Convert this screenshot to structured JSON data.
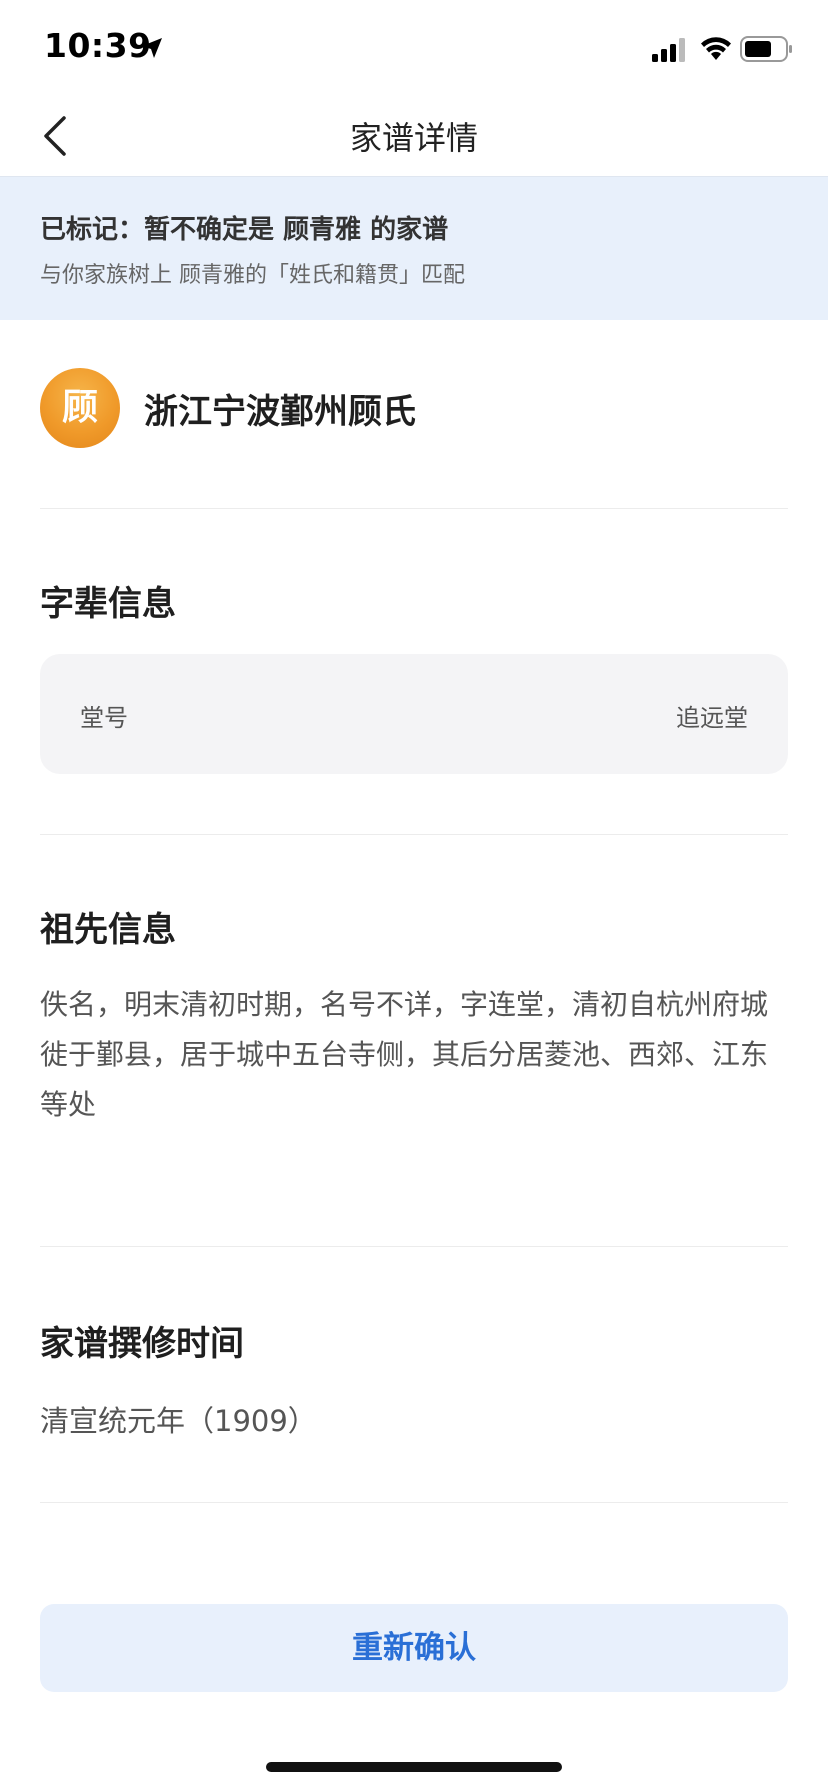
{
  "status_bar": {
    "time": "10:39",
    "icons": [
      "location-arrow-icon",
      "signal-icon",
      "wifi-icon",
      "battery-icon"
    ]
  },
  "nav": {
    "back_icon": "chevron-left-icon",
    "title": "家谱详情"
  },
  "notice": {
    "title": "已标记：暂不确定是 顾青雅 的家谱",
    "subtitle": "与你家族树上 顾青雅的「姓氏和籍贯」匹配",
    "background": "#e8f0fb"
  },
  "genealogy": {
    "avatar_text": "顾",
    "name": "浙江宁波鄞州顾氏",
    "avatar_color": "#f09a2a"
  },
  "generation_section": {
    "title": "字辈信息",
    "rows": [
      {
        "label": "堂号",
        "value": "追远堂"
      }
    ]
  },
  "ancestor_section": {
    "title": "祖先信息",
    "description": "佚名，明末清初时期，名号不详，字连堂，清初自杭州府城徙于鄞县，居于城中五台寺侧，其后分居菱池、西郊、江东等处"
  },
  "compile_section": {
    "title": "家谱撰修时间",
    "value": "清宣统元年（1909）"
  },
  "actions": {
    "reconfirm_label": "重新确认",
    "accent_color": "#2a6fd6"
  }
}
